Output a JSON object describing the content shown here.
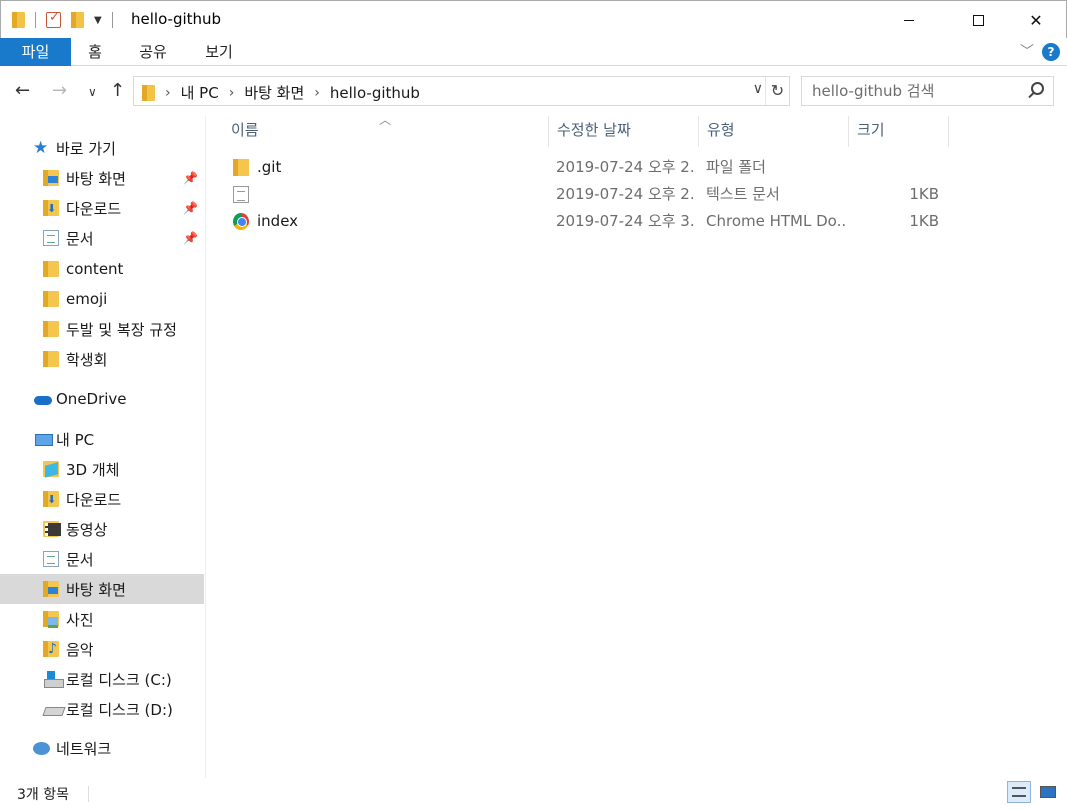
{
  "window": {
    "title": "hello-github",
    "minimize": "",
    "maximize": "",
    "close": "✕"
  },
  "ribbon": {
    "tabs": [
      "파일",
      "홈",
      "공유",
      "보기"
    ],
    "help": "?"
  },
  "address": {
    "crumbs": [
      "내 PC",
      "바탕 화면",
      "hello-github"
    ],
    "separator": "›",
    "search_placeholder": "hello-github 검색"
  },
  "sidebar": {
    "items": [
      {
        "label": "바로 가기",
        "icon": "star-icon",
        "pinned": false
      },
      {
        "label": "바탕 화면",
        "icon": "desktop-folder-icon",
        "pinned": true
      },
      {
        "label": "다운로드",
        "icon": "downloads-folder-icon",
        "pinned": true
      },
      {
        "label": "문서",
        "icon": "documents-icon",
        "pinned": true
      },
      {
        "label": "content",
        "icon": "folder-icon",
        "pinned": false
      },
      {
        "label": "emoji",
        "icon": "folder-icon",
        "pinned": false
      },
      {
        "label": "두발 및 복장 규정",
        "icon": "folder-icon",
        "pinned": false
      },
      {
        "label": "학생회",
        "icon": "folder-icon",
        "pinned": false
      },
      {
        "label": "OneDrive",
        "icon": "onedrive-cloud-icon",
        "pinned": false
      },
      {
        "label": "내 PC",
        "icon": "this-pc-icon",
        "pinned": false
      },
      {
        "label": "3D 개체",
        "icon": "3d-objects-icon",
        "pinned": false
      },
      {
        "label": "다운로드",
        "icon": "downloads-folder-icon",
        "pinned": false
      },
      {
        "label": "동영상",
        "icon": "videos-icon",
        "pinned": false
      },
      {
        "label": "문서",
        "icon": "documents-icon",
        "pinned": false
      },
      {
        "label": "바탕 화면",
        "icon": "desktop-folder-icon",
        "pinned": false,
        "selected": true
      },
      {
        "label": "사진",
        "icon": "pictures-icon",
        "pinned": false
      },
      {
        "label": "음악",
        "icon": "music-icon",
        "pinned": false
      },
      {
        "label": "로컬 디스크 (C:)",
        "icon": "drive-c-icon",
        "pinned": false
      },
      {
        "label": "로컬 디스크 (D:)",
        "icon": "drive-d-icon",
        "pinned": false
      },
      {
        "label": "네트워크",
        "icon": "network-icon",
        "pinned": false
      }
    ],
    "pin_glyph": "📌"
  },
  "columns": {
    "name": "이름",
    "date": "수정한 날짜",
    "type": "유형",
    "size": "크기"
  },
  "files": [
    {
      "name": ".git",
      "date": "2019-07-24 오후 2...",
      "type": "파일 폴더",
      "size": "",
      "icon": "folder-icon"
    },
    {
      "name": "",
      "date": "2019-07-24 오후 2...",
      "type": "텍스트 문서",
      "size": "1KB",
      "icon": "text-file-icon"
    },
    {
      "name": "index",
      "date": "2019-07-24 오후 3...",
      "type": "Chrome HTML Do...",
      "size": "1KB",
      "icon": "chrome-icon"
    }
  ],
  "status": {
    "count": "3개 항목"
  },
  "colors": {
    "accent": "#1979ca",
    "selected_bg": "#d9d9d9",
    "header_text": "#4c607a"
  }
}
